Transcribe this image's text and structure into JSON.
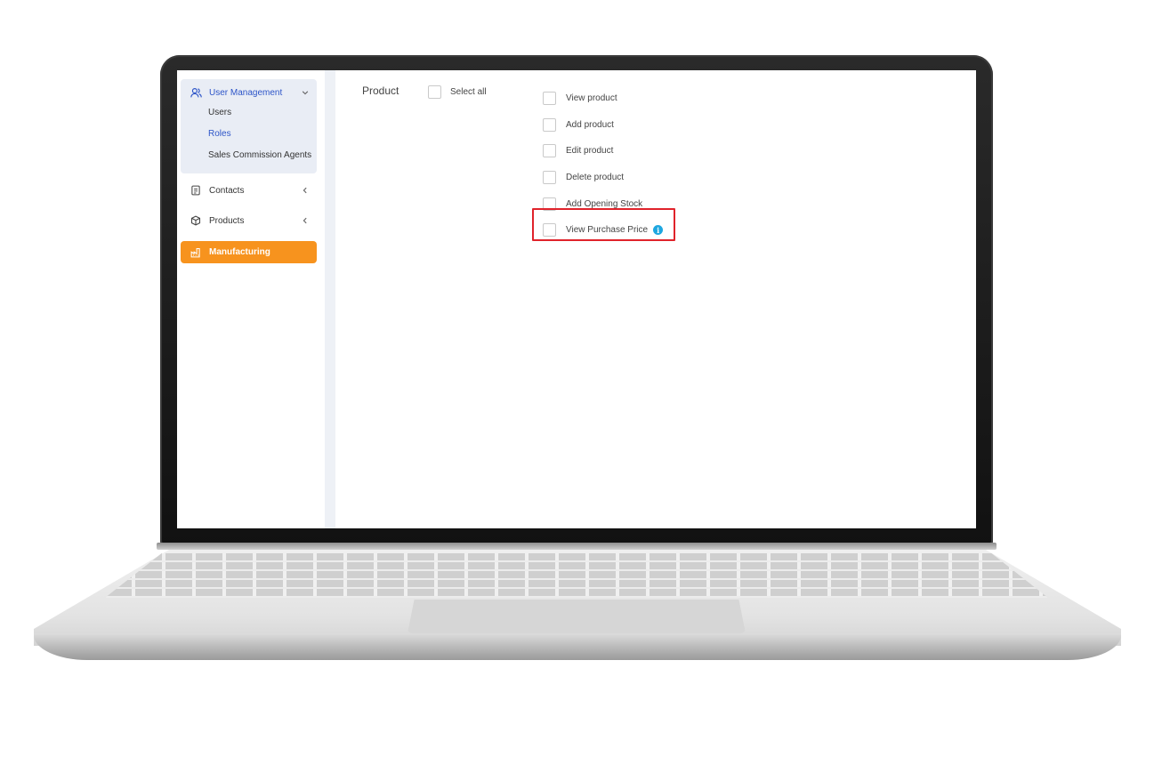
{
  "sidebar": {
    "group": {
      "label": "User Management",
      "icon": "users-icon",
      "items": [
        {
          "label": "Users",
          "active": false
        },
        {
          "label": "Roles",
          "active": true
        },
        {
          "label": "Sales Commission Agents",
          "active": false
        }
      ]
    },
    "items": [
      {
        "label": "Contacts",
        "icon": "contacts-icon"
      },
      {
        "label": "Products",
        "icon": "box-icon"
      }
    ],
    "active_item": {
      "label": "Manufacturing",
      "icon": "factory-icon"
    }
  },
  "permissions": {
    "section_title": "Product",
    "select_all_label": "Select all",
    "items": [
      {
        "label": "View product",
        "checked": false
      },
      {
        "label": "Add product",
        "checked": false
      },
      {
        "label": "Edit product",
        "checked": false
      },
      {
        "label": "Delete product",
        "checked": false
      },
      {
        "label": "Add Opening Stock",
        "checked": false
      },
      {
        "label": "View Purchase Price",
        "checked": false,
        "highlighted": true,
        "info_icon": "info-icon"
      }
    ]
  },
  "colors": {
    "accent_blue": "#2d55c8",
    "active_orange": "#f7931e",
    "highlight_red": "#e0232b",
    "info_blue": "#1ea7e0"
  }
}
